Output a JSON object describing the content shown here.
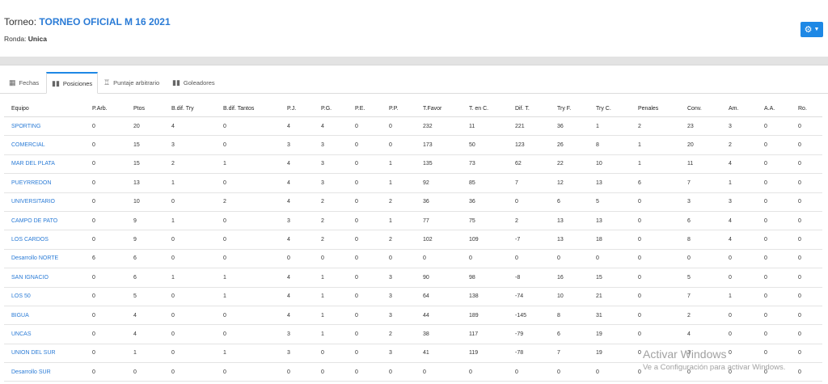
{
  "header": {
    "torneo_label": "Torneo:",
    "torneo_name": "TORNEO OFICIAL M 16 2021",
    "ronda_label": "Ronda:",
    "ronda_value": "Unica",
    "settings_icon": "gear-icon",
    "settings_caret": "chevron-down-icon"
  },
  "tabs": [
    {
      "label": "Fechas",
      "icon": "calendar-icon",
      "active": false
    },
    {
      "label": "Posiciones",
      "icon": "bar-chart-icon",
      "active": true
    },
    {
      "label": "Puntaje arbitrario",
      "icon": "trophy-icon",
      "active": false
    },
    {
      "label": "Goleadores",
      "icon": "bar-chart-icon",
      "active": false
    }
  ],
  "table": {
    "columns": [
      "Equipo",
      "P.Arb.",
      "Ptos",
      "B.dif. Try",
      "B.dif. Tantos",
      "P.J.",
      "P.G.",
      "P.E.",
      "P.P.",
      "T.Favor",
      "T. en C.",
      "Dif. T.",
      "Try F.",
      "Try C.",
      "Penales",
      "Conv.",
      "Am.",
      "A.A.",
      "Ro."
    ],
    "rows": [
      [
        "SPORTING",
        "0",
        "20",
        "4",
        "0",
        "4",
        "4",
        "0",
        "0",
        "232",
        "11",
        "221",
        "36",
        "1",
        "2",
        "23",
        "3",
        "0",
        "0"
      ],
      [
        "COMERCIAL",
        "0",
        "15",
        "3",
        "0",
        "3",
        "3",
        "0",
        "0",
        "173",
        "50",
        "123",
        "26",
        "8",
        "1",
        "20",
        "2",
        "0",
        "0"
      ],
      [
        "MAR DEL PLATA",
        "0",
        "15",
        "2",
        "1",
        "4",
        "3",
        "0",
        "1",
        "135",
        "73",
        "62",
        "22",
        "10",
        "1",
        "11",
        "4",
        "0",
        "0"
      ],
      [
        "PUEYRREDON",
        "0",
        "13",
        "1",
        "0",
        "4",
        "3",
        "0",
        "1",
        "92",
        "85",
        "7",
        "12",
        "13",
        "6",
        "7",
        "1",
        "0",
        "0"
      ],
      [
        "UNIVERSITARIO",
        "0",
        "10",
        "0",
        "2",
        "4",
        "2",
        "0",
        "2",
        "36",
        "36",
        "0",
        "6",
        "5",
        "0",
        "3",
        "3",
        "0",
        "0"
      ],
      [
        "CAMPO DE PATO",
        "0",
        "9",
        "1",
        "0",
        "3",
        "2",
        "0",
        "1",
        "77",
        "75",
        "2",
        "13",
        "13",
        "0",
        "6",
        "4",
        "0",
        "0"
      ],
      [
        "LOS CARDOS",
        "0",
        "9",
        "0",
        "0",
        "4",
        "2",
        "0",
        "2",
        "102",
        "109",
        "-7",
        "13",
        "18",
        "0",
        "8",
        "4",
        "0",
        "0"
      ],
      [
        "Desarrollo NORTE",
        "6",
        "6",
        "0",
        "0",
        "0",
        "0",
        "0",
        "0",
        "0",
        "0",
        "0",
        "0",
        "0",
        "0",
        "0",
        "0",
        "0",
        "0"
      ],
      [
        "SAN IGNACIO",
        "0",
        "6",
        "1",
        "1",
        "4",
        "1",
        "0",
        "3",
        "90",
        "98",
        "-8",
        "16",
        "15",
        "0",
        "5",
        "0",
        "0",
        "0"
      ],
      [
        "LOS 50",
        "0",
        "5",
        "0",
        "1",
        "4",
        "1",
        "0",
        "3",
        "64",
        "138",
        "-74",
        "10",
        "21",
        "0",
        "7",
        "1",
        "0",
        "0"
      ],
      [
        "BIGUA",
        "0",
        "4",
        "0",
        "0",
        "4",
        "1",
        "0",
        "3",
        "44",
        "189",
        "-145",
        "8",
        "31",
        "0",
        "2",
        "0",
        "0",
        "0"
      ],
      [
        "UNCAS",
        "0",
        "4",
        "0",
        "0",
        "3",
        "1",
        "0",
        "2",
        "38",
        "117",
        "-79",
        "6",
        "19",
        "0",
        "4",
        "0",
        "0",
        "0"
      ],
      [
        "UNION DEL SUR",
        "0",
        "1",
        "0",
        "1",
        "3",
        "0",
        "0",
        "3",
        "41",
        "119",
        "-78",
        "7",
        "19",
        "0",
        "3",
        "0",
        "0",
        "0"
      ],
      [
        "Desarrollo SUR",
        "0",
        "0",
        "0",
        "0",
        "0",
        "0",
        "0",
        "0",
        "0",
        "0",
        "0",
        "0",
        "0",
        "0",
        "0",
        "0",
        "0",
        "0"
      ]
    ]
  },
  "watermark": {
    "line1": "Activar Windows",
    "line2": "Ve a Configuración para activar Windows."
  }
}
